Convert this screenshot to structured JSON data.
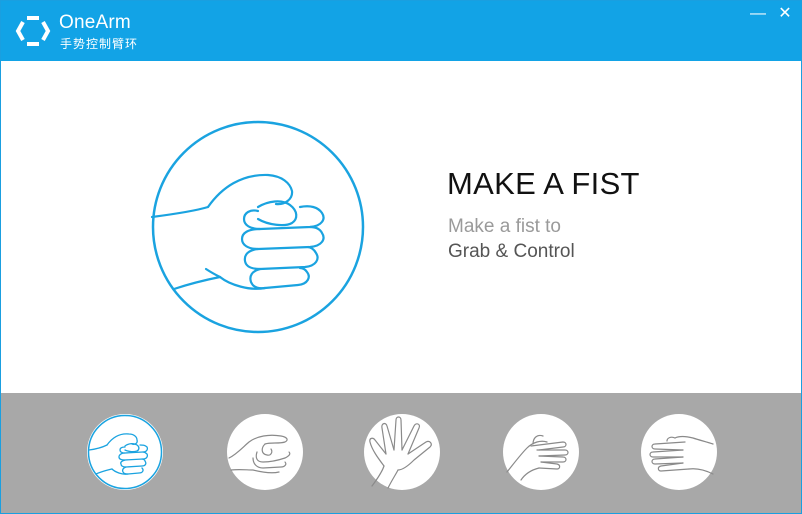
{
  "titlebar": {
    "app_name": "OneArm",
    "app_subtitle": "手势控制臂环",
    "minimize_glyph": "—",
    "close_glyph": "✕",
    "background_color": "#12a3e6"
  },
  "main": {
    "heading": "MAKE A FIST",
    "subtitle_line1": "Make a fist to",
    "subtitle_line2": "Grab & Control",
    "illustration_icon": "fist-icon",
    "accent_color": "#1aa3e0"
  },
  "gestures": [
    {
      "icon": "fist-icon",
      "selected": true
    },
    {
      "icon": "pinch-icon",
      "selected": false
    },
    {
      "icon": "open-hand-icon",
      "selected": false
    },
    {
      "icon": "wave-in-icon",
      "selected": false
    },
    {
      "icon": "wave-out-icon",
      "selected": false
    }
  ],
  "bottombar": {
    "background_color": "#a8a8a8"
  }
}
